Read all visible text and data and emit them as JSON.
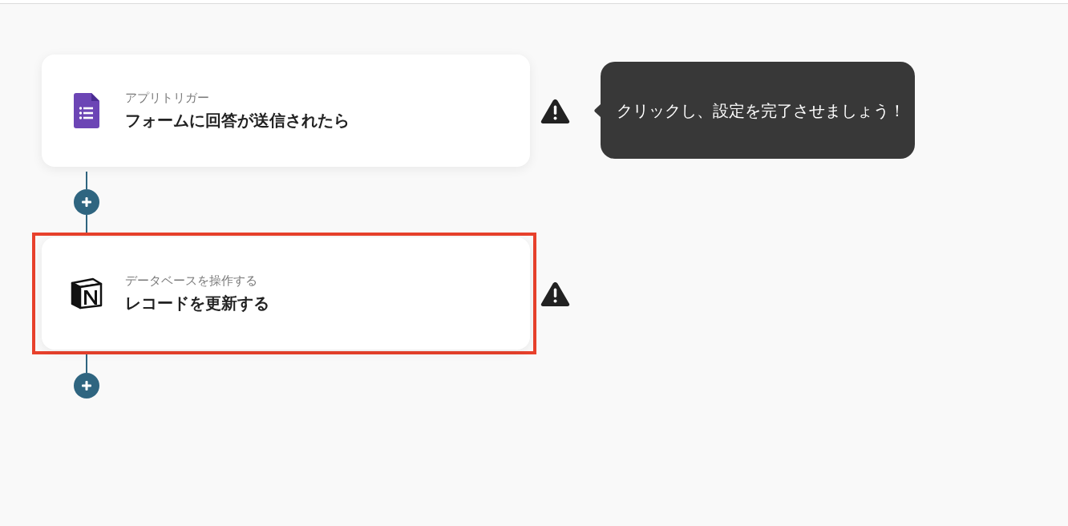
{
  "steps": [
    {
      "kind": "google-forms",
      "label": "アプリトリガー",
      "title": "フォームに回答が送信されたら",
      "highlighted": false,
      "warning": true
    },
    {
      "kind": "notion",
      "label": "データベースを操作する",
      "title": "レコードを更新する",
      "highlighted": true,
      "warning": true
    }
  ],
  "tooltip": {
    "text": "クリックし、設定を完了させましょう！"
  }
}
